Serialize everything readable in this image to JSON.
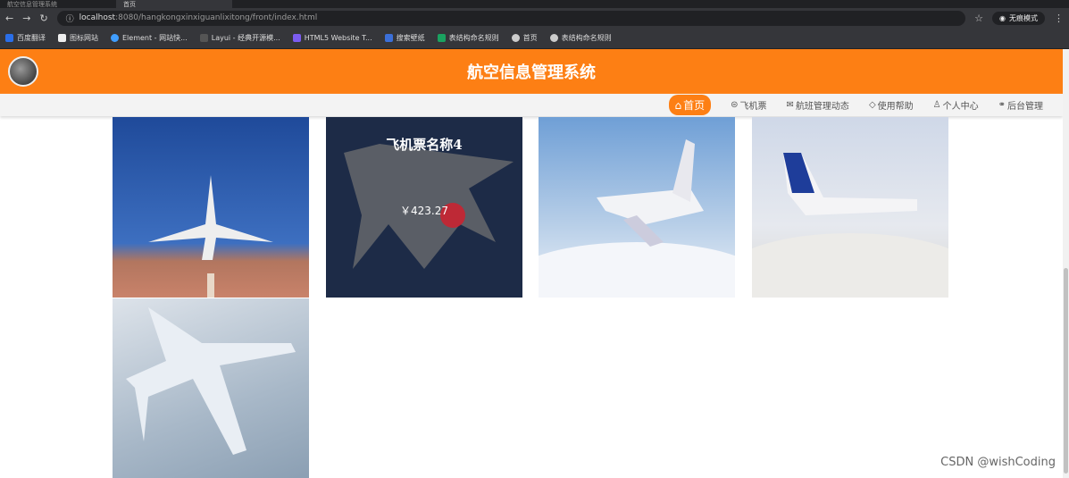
{
  "browser": {
    "tabs": [
      {
        "label": "航空信息管理系统"
      },
      {
        "label": "首页"
      }
    ],
    "url_host": "localhost",
    "url_rest": ":8080/hangkongxinxiguanlixitong/front/index.html",
    "profile": "无痕模式",
    "bookmarks": [
      "百度翻译",
      "图标网站",
      "Element - 网站快...",
      "Layui - 经典开源模...",
      "HTML5 Website T...",
      "搜索壁纸",
      "表结构命名规则",
      "首页",
      "表结构命名规则"
    ]
  },
  "header": {
    "title": "航空信息管理系统"
  },
  "nav": [
    {
      "label": "首页",
      "icon": "home-icon"
    },
    {
      "label": "飞机票",
      "icon": "ticket-icon"
    },
    {
      "label": "航班管理动态",
      "icon": "mail-icon"
    },
    {
      "label": "使用帮助",
      "icon": "tag-icon"
    },
    {
      "label": "个人中心",
      "icon": "user-icon"
    },
    {
      "label": "后台管理",
      "icon": "link-icon"
    }
  ],
  "hover_card": {
    "name": "飞机票名称4",
    "price": "￥423.27"
  },
  "watermark": "CSDN @wishCoding"
}
